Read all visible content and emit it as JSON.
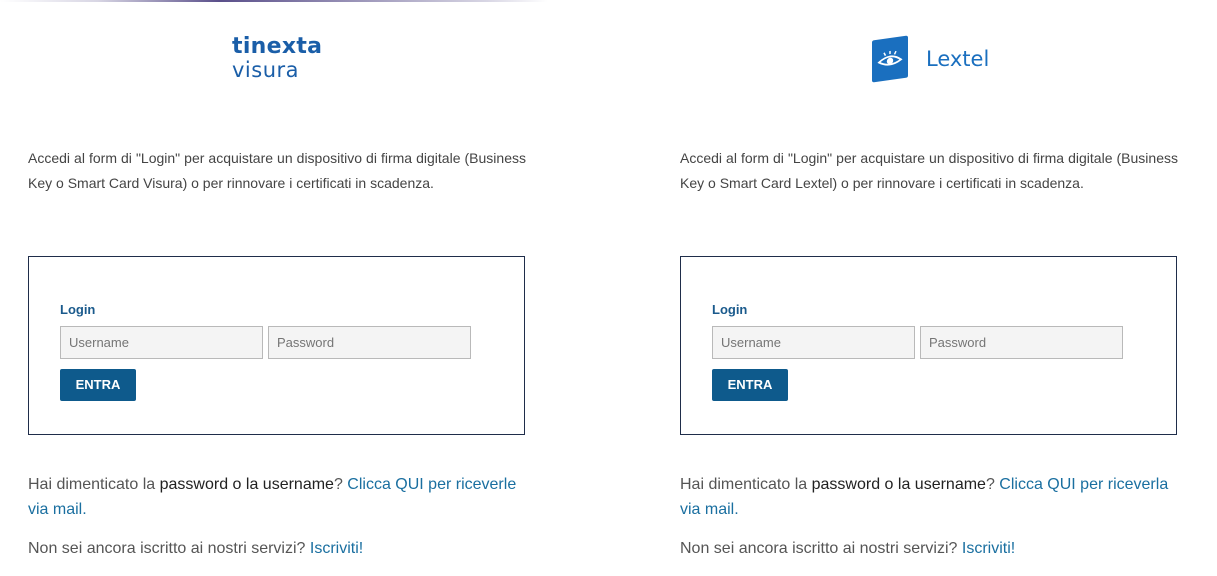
{
  "left": {
    "logo_line1": "tinexta",
    "logo_line2": "visura",
    "intro": "Accedi al form di \"Login\" per acquistare un dispositivo di firma digitale (Business Key o Smart Card Visura) o per rinnovare i certificati in scadenza.",
    "login_label": "Login",
    "username_placeholder": "Username",
    "password_placeholder": "Password",
    "enter_label": "ENTRA",
    "forgot_prefix": "Hai dimenticato la ",
    "forgot_strong": "password o la username",
    "forgot_q": "? ",
    "forgot_link": "Clicca QUI per riceverle via mail.",
    "signup_prefix": "Non sei ancora iscritto ai nostri servizi? ",
    "signup_link": "Iscriviti!"
  },
  "right": {
    "logo_name": "Lextel",
    "intro": "Accedi al form di \"Login\" per acquistare un dispositivo di firma digitale (Business Key o Smart Card Lextel) o per rinnovare i certificati in scadenza.",
    "login_label": "Login",
    "username_placeholder": "Username",
    "password_placeholder": "Password",
    "enter_label": "ENTRA",
    "forgot_prefix": "Hai dimenticato la ",
    "forgot_strong": "password o la username",
    "forgot_q": "? ",
    "forgot_link": "Clicca QUI per riceverla via mail.",
    "signup_prefix": "Non sei ancora iscritto ai nostri servizi? ",
    "signup_link": "Iscriviti!"
  },
  "colors": {
    "brand_blue": "#1a5ea8",
    "button_blue": "#0e5a8c",
    "link_blue": "#1a6fa0"
  }
}
